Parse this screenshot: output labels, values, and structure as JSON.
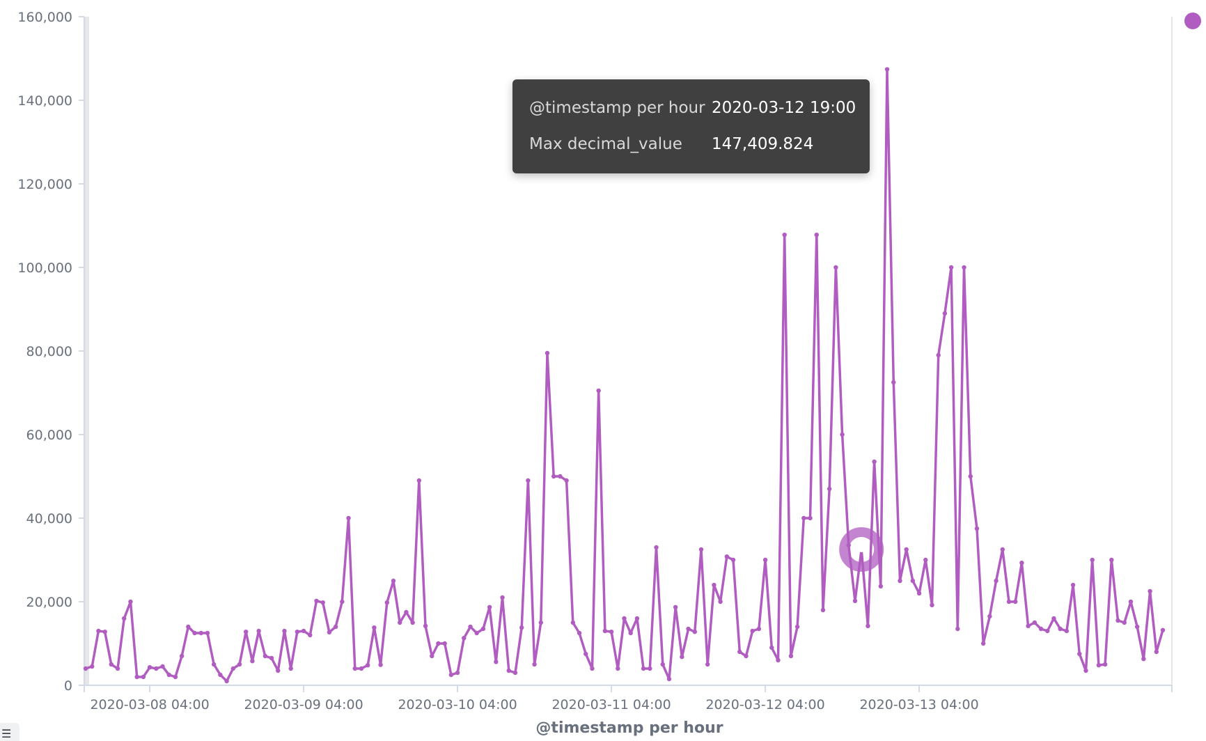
{
  "chart_data": {
    "type": "line",
    "xlabel": "@timestamp per hour",
    "ylabel": "Max decimal_value",
    "ylim": [
      0,
      160000
    ],
    "y_ticks": [
      0,
      20000,
      40000,
      60000,
      80000,
      100000,
      120000,
      140000,
      160000
    ],
    "y_tick_labels": [
      "0",
      "20,000",
      "40,000",
      "60,000",
      "80,000",
      "100,000",
      "120,000",
      "140,000",
      "160,000"
    ],
    "x_start": "2020-03-07 18:00",
    "x_step": "1 hour",
    "x_tick_labels": [
      "2020-03-08 04:00",
      "2020-03-09 04:00",
      "2020-03-10 04:00",
      "2020-03-11 04:00",
      "2020-03-12 04:00",
      "2020-03-13 04:00"
    ],
    "x_tick_hours": [
      10,
      34,
      58,
      82,
      106,
      130
    ],
    "x_ticks_unlabeled_hours": [
      0,
      169
    ],
    "grid": false,
    "color": "#b05cc0",
    "series": [
      {
        "name": "Max decimal_value",
        "values": [
          4000,
          4500,
          13000,
          12800,
          5000,
          4000,
          16000,
          20000,
          2000,
          2000,
          4300,
          4000,
          4500,
          2500,
          2000,
          7000,
          14000,
          12500,
          12500,
          12500,
          5000,
          2500,
          1000,
          4000,
          5000,
          12800,
          5800,
          13000,
          7000,
          6500,
          3500,
          13000,
          4000,
          12800,
          13000,
          12000,
          20200,
          19800,
          12700,
          14000,
          20000,
          40000,
          4000,
          4000,
          4800,
          13800,
          4900,
          19800,
          25000,
          15000,
          17500,
          15000,
          49000,
          14200,
          7000,
          10000,
          10000,
          2500,
          3000,
          11300,
          14000,
          12500,
          13500,
          18700,
          5600,
          21000,
          3500,
          3000,
          13800,
          49000,
          5000,
          15000,
          79500,
          50000,
          50000,
          49000,
          15000,
          12500,
          7500,
          4000,
          70500,
          13000,
          12800,
          4000,
          16000,
          12500,
          16000,
          4000,
          4000,
          33000,
          5000,
          1500,
          18700,
          6800,
          13500,
          12800,
          32500,
          5000,
          24000,
          20000,
          30800,
          30000,
          8000,
          7000,
          13000,
          13500,
          30000,
          9000,
          6000,
          107800,
          7000,
          14000,
          40000,
          40000,
          107800,
          18000,
          47000,
          100000,
          60000,
          33500,
          20200,
          32500,
          14200,
          53500,
          23700,
          147409.824,
          72500,
          25000,
          32500,
          25000,
          22000,
          30000,
          19200,
          79000,
          89000,
          100000,
          13500,
          100000,
          50000,
          37500,
          10000,
          16500,
          25000,
          32500,
          20000,
          20000,
          29300,
          14200,
          15000,
          13500,
          13000,
          16000,
          13500,
          13000,
          24000,
          7500,
          3500,
          30000,
          4800,
          5000,
          30000,
          15500,
          15000,
          20000,
          14000,
          6300,
          22500,
          8000,
          13200
        ]
      }
    ],
    "highlight": {
      "index": 121,
      "timestamp": "2020-03-12 19:00",
      "value": 147409.824
    }
  },
  "tooltip": {
    "row1_key": "@timestamp per hour",
    "row1_value": "2020-03-12 19:00",
    "row2_key": "Max decimal_value",
    "row2_value": "147,409.824"
  },
  "menu_icon": "hamburger-menu-icon"
}
